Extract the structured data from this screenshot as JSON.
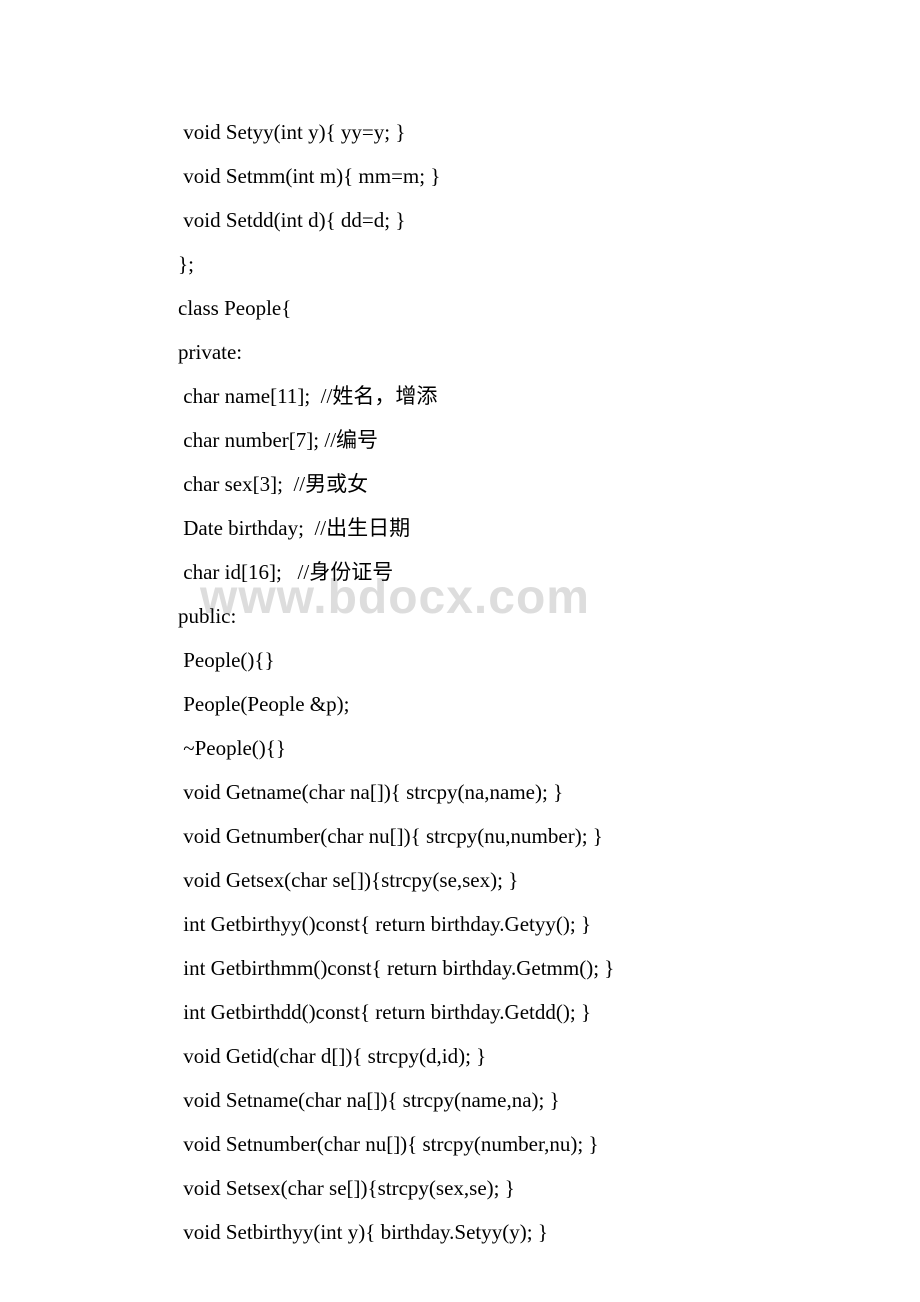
{
  "watermark": "www.bdocx.com",
  "lines": [
    " void Setyy(int y){ yy=y; }",
    " void Setmm(int m){ mm=m; }",
    " void Setdd(int d){ dd=d; }",
    "};",
    "class People{",
    "private:",
    " char name[11];  //姓名，增添",
    " char number[7]; //编号",
    " char sex[3];  //男或女",
    " Date birthday;  //出生日期",
    " char id[16];   //身份证号",
    "public:",
    " People(){}",
    " People(People &p);",
    " ~People(){}",
    " void Getname(char na[]){ strcpy(na,name); }",
    " void Getnumber(char nu[]){ strcpy(nu,number); }",
    " void Getsex(char se[]){strcpy(se,sex); }",
    " int Getbirthyy()const{ return birthday.Getyy(); }",
    " int Getbirthmm()const{ return birthday.Getmm(); }",
    " int Getbirthdd()const{ return birthday.Getdd(); }",
    " void Getid(char d[]){ strcpy(d,id); }",
    " void Setname(char na[]){ strcpy(name,na); }",
    " void Setnumber(char nu[]){ strcpy(number,nu); }",
    " void Setsex(char se[]){strcpy(sex,se); }",
    " void Setbirthyy(int y){ birthday.Setyy(y); }"
  ]
}
